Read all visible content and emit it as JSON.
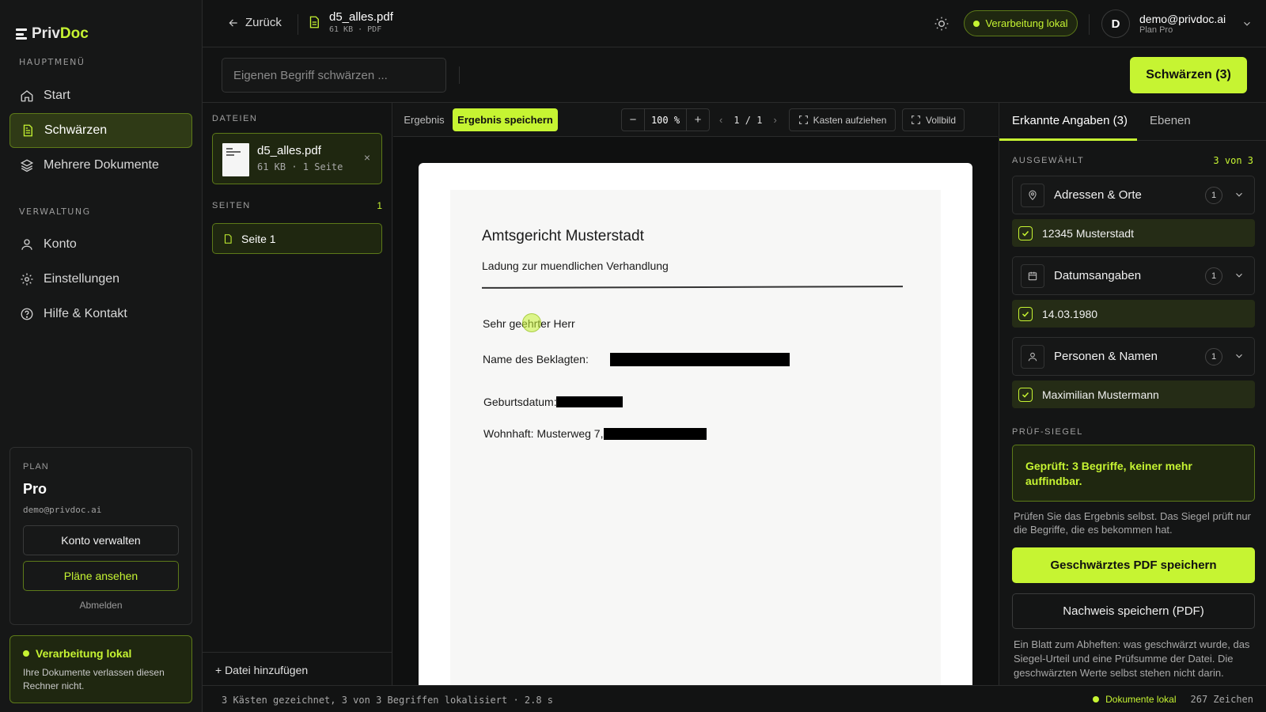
{
  "brand": {
    "name_a": "Priv",
    "name_b": "Doc"
  },
  "sidebar": {
    "main_label": "HAUPTMENÜ",
    "main_items": [
      {
        "label": "Start",
        "icon": "home-icon"
      },
      {
        "label": "Schwärzen",
        "icon": "document-icon",
        "active": true
      },
      {
        "label": "Mehrere Dokumente",
        "icon": "layers-icon"
      }
    ],
    "admin_label": "VERWALTUNG",
    "admin_items": [
      {
        "label": "Konto",
        "icon": "user-icon"
      },
      {
        "label": "Einstellungen",
        "icon": "gear-icon"
      },
      {
        "label": "Hilfe & Kontakt",
        "icon": "help-icon"
      }
    ],
    "plan": {
      "label": "PLAN",
      "name": "Pro",
      "email": "demo@privdoc.ai",
      "manage_button": "Konto verwalten",
      "plans_button": "Pläne ansehen",
      "logout": "Abmelden"
    },
    "local": {
      "title": "Verarbeitung lokal",
      "text": "Ihre Dokumente verlassen diesen Rechner nicht."
    }
  },
  "topbar": {
    "back": "Zurück",
    "file_name": "d5_alles.pdf",
    "file_meta": "61 KB · PDF",
    "local_pill": "Verarbeitung lokal",
    "avatar_letter": "D",
    "user_email": "demo@privdoc.ai",
    "user_plan": "Plan Pro"
  },
  "search": {
    "placeholder": "Eigenen Begriff schwärzen ...",
    "value": "",
    "redact_button": "Schwärzen (3)"
  },
  "files_panel": {
    "files_label": "DATEIEN",
    "file": {
      "name": "d5_alles.pdf",
      "meta": "61 KB · 1 Seite",
      "remove": "×"
    },
    "pages_label": "SEITEN",
    "pages_count": "1",
    "page": "Seite 1",
    "add_file": "+ Datei hinzufügen"
  },
  "viewer": {
    "tab_result": "Ergebnis",
    "tab_save": "Ergebnis speichern",
    "zoom_minus": "−",
    "zoom_value": "100 %",
    "zoom_plus": "+",
    "page_indicator": "1 / 1",
    "draw_boxes": "Kasten aufziehen",
    "fullscreen": "Vollbild",
    "document": {
      "court": "Amtsgericht Musterstadt",
      "subject": "Ladung zur muendlichen Verhandlung",
      "salutation": "Sehr geehrter Herr",
      "name_label": "Name des Beklagten:",
      "birth_label": "Geburtsdatum:",
      "address_label": "Wohnhaft: Musterweg 7,"
    }
  },
  "right_panel": {
    "tab_detected": "Erkannte Angaben (3)",
    "tab_layers": "Ebenen",
    "selected_label": "AUSGEWÄHLT",
    "selected_count": "3 von 3",
    "categories": [
      {
        "name": "Adressen & Orte",
        "count": "1",
        "icon": "location-pin-icon",
        "entry": "12345 Musterstadt"
      },
      {
        "name": "Datumsangaben",
        "count": "1",
        "icon": "calendar-icon",
        "entry": "14.03.1980"
      },
      {
        "name": "Personen & Namen",
        "count": "1",
        "icon": "person-icon",
        "entry": "Maximilian Mustermann"
      }
    ],
    "seal_label": "PRÜF-SIEGEL",
    "seal_text": "Geprüft: 3 Begriffe, keiner mehr auffindbar.",
    "seal_note": "Prüfen Sie das Ergebnis selbst. Das Siegel prüft nur die Begriffe, die es bekommen hat.",
    "save_pdf": "Geschwärztes PDF speichern",
    "save_proof": "Nachweis speichern (PDF)",
    "proof_note": "Ein Blatt zum Abheften: was geschwärzt wurde, das Siegel-Urteil und eine Prüfsumme der Datei. Die geschwärzten Werte selbst stehen nicht darin."
  },
  "statusbar": {
    "left": "3 Kästen gezeichnet, 3 von 3 Begriffen lokalisiert · 2.8 s",
    "local": "Dokumente lokal",
    "chars": "267 Zeichen"
  },
  "colors": {
    "accent": "#c6f432",
    "accent_bg": "#1f2710",
    "background": "#121313"
  }
}
